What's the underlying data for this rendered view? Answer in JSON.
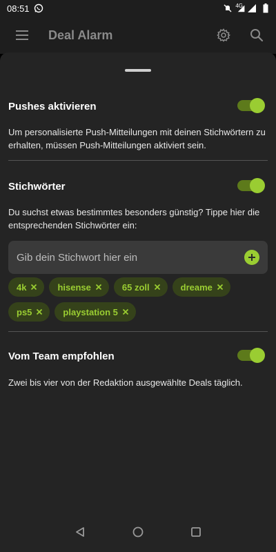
{
  "status_bar": {
    "time": "08:51",
    "icons": [
      "whatsapp-icon",
      "mute-icon",
      "signal-4g-icon",
      "signal-icon",
      "battery-icon"
    ],
    "network_label": "4G"
  },
  "app_bar": {
    "title": "Deal Alarm",
    "icons": [
      "menu-icon",
      "settings-icon",
      "search-icon"
    ]
  },
  "sections": {
    "push": {
      "title": "Pushes aktivieren",
      "enabled": true,
      "description": "Um personalisierte Push-Mitteilungen mit deinen Stichwörtern zu erhalten, müssen Push-Mitteilungen aktiviert sein."
    },
    "keywords": {
      "title": "Stichwörter",
      "enabled": true,
      "description": "Du suchst etwas bestimmtes besonders günstig? Tippe hier die entsprechenden Stichwörter ein:",
      "input_placeholder": "Gib dein Stichwort hier ein",
      "input_value": "",
      "chips": [
        "4k",
        "hisense",
        "65 zoll",
        "dreame",
        "ps5",
        "playstation 5"
      ]
    },
    "team": {
      "title": "Vom Team empfohlen",
      "enabled": true,
      "description": "Zwei bis vier von der Redaktion ausgewählte Deals täglich."
    }
  },
  "colors": {
    "accent": "#9acd32",
    "toggle_track": "#5d7a1b",
    "chip_bg": "#35421a",
    "sheet_bg": "#242424",
    "field_bg": "#3a3a3a"
  },
  "nav_bar": {
    "icons": [
      "back-icon",
      "home-icon",
      "recents-icon"
    ]
  }
}
